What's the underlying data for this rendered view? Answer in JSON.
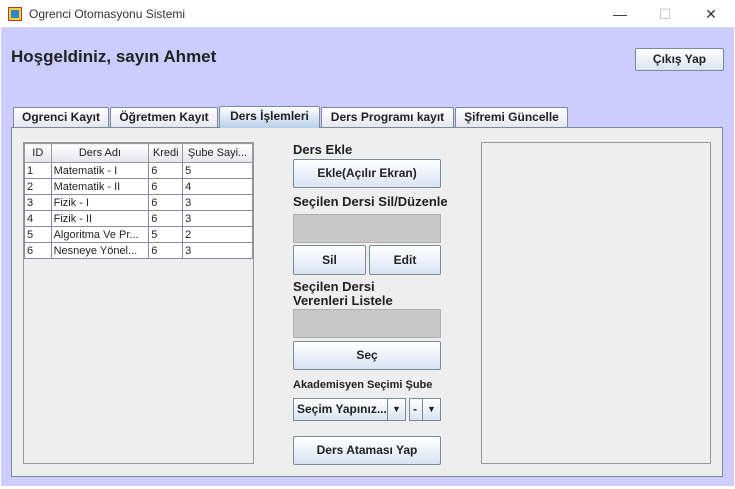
{
  "window": {
    "title": "Ogrenci Otomasyonu Sistemi",
    "min": "—",
    "max": "☐",
    "close": "✕"
  },
  "header": {
    "welcome": "Hoşgeldiniz, sayın Ahmet",
    "logout_label": "Çıkış Yap"
  },
  "tabs": [
    {
      "label": "Ogrenci Kayıt",
      "selected": false
    },
    {
      "label": "Öğretmen Kayıt",
      "selected": false
    },
    {
      "label": "Ders İşlemleri",
      "selected": true
    },
    {
      "label": "Ders Programı kayıt",
      "selected": false
    },
    {
      "label": "Şifremi Güncelle",
      "selected": false
    }
  ],
  "table": {
    "columns": [
      "ID",
      "Ders Adı",
      "Kredi",
      "Şube Sayi..."
    ],
    "rows": [
      [
        "1",
        "Matematik - I",
        "6",
        "5"
      ],
      [
        "2",
        "Matematik - II",
        "6",
        "4"
      ],
      [
        "3",
        "Fizik - I",
        "6",
        "3"
      ],
      [
        "4",
        "Fizik - II",
        "6",
        "3"
      ],
      [
        "5",
        "Algoritma Ve Pr...",
        "5",
        "2"
      ],
      [
        "6",
        "Nesneye Yönel...",
        "6",
        "3"
      ]
    ]
  },
  "actions": {
    "add_heading": "Ders Ekle",
    "add_button": "Ekle(Açılır Ekran)",
    "edit_heading": "Seçilen Dersi Sil/Düzenle",
    "delete_button": "Sil",
    "edit_button": "Edit",
    "list_heading_1": "Seçilen Dersi",
    "list_heading_2": "Verenleri Listele",
    "select_button": "Seç",
    "assign_heading": "Akademisyen Seçimi Şube",
    "academic_combo": "Seçim Yapınız...",
    "branch_combo": "-",
    "assign_button": "Ders Ataması Yap"
  }
}
